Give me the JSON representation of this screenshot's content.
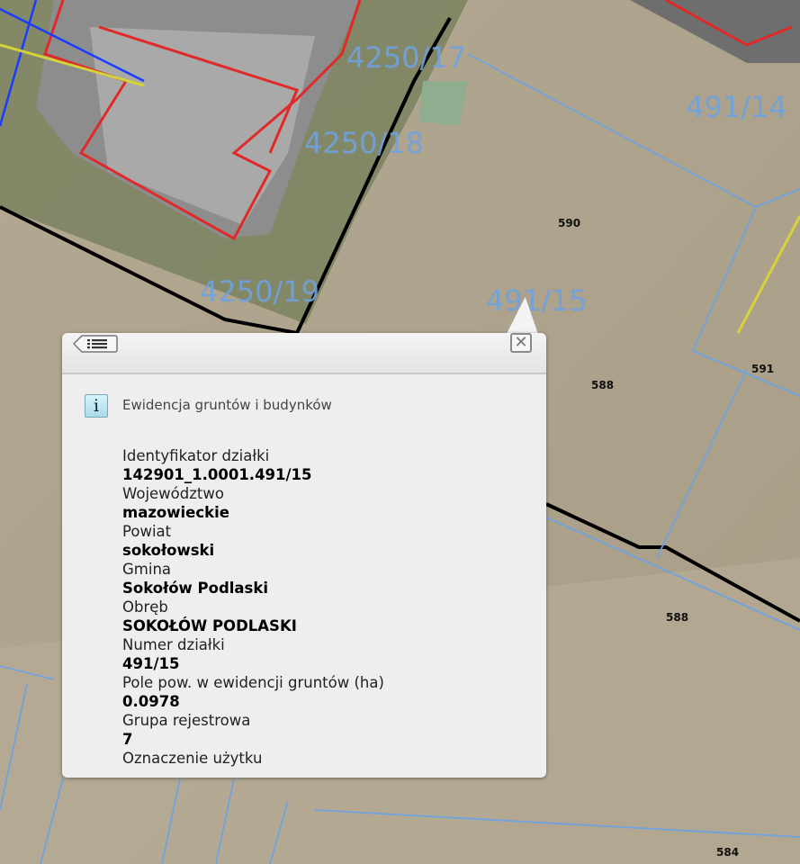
{
  "map": {
    "parcel_labels": [
      "4250/17",
      "4250/18",
      "4250/19",
      "491/14",
      "491/15"
    ],
    "height_labels": [
      "590",
      "588",
      "591",
      "588",
      "584"
    ],
    "colors": {
      "parcel_lines": "#6fa3df",
      "building_lines": "#e02a2a",
      "boundary": "#000000",
      "utility": "#d6d23a"
    }
  },
  "popup": {
    "back_icon": "list-back-icon",
    "close_icon": "close-icon",
    "info_icon": "i",
    "source_title": "Ewidencja gruntów i budynków",
    "fields": [
      {
        "label": "Identyfikator działki",
        "value": "142901_1.0001.491/15"
      },
      {
        "label": "Województwo",
        "value": "mazowieckie"
      },
      {
        "label": "Powiat",
        "value": "sokołowski"
      },
      {
        "label": "Gmina",
        "value": "Sokołów Podlaski"
      },
      {
        "label": "Obręb",
        "value": "SOKOŁÓW PODLASKI"
      },
      {
        "label": "Numer działki",
        "value": "491/15"
      },
      {
        "label": "Pole pow. w ewidencji gruntów (ha)",
        "value": "0.0978"
      },
      {
        "label": "Grupa rejestrowa",
        "value": "7"
      },
      {
        "label": "Oznaczenie użytku",
        "value": ""
      }
    ]
  }
}
